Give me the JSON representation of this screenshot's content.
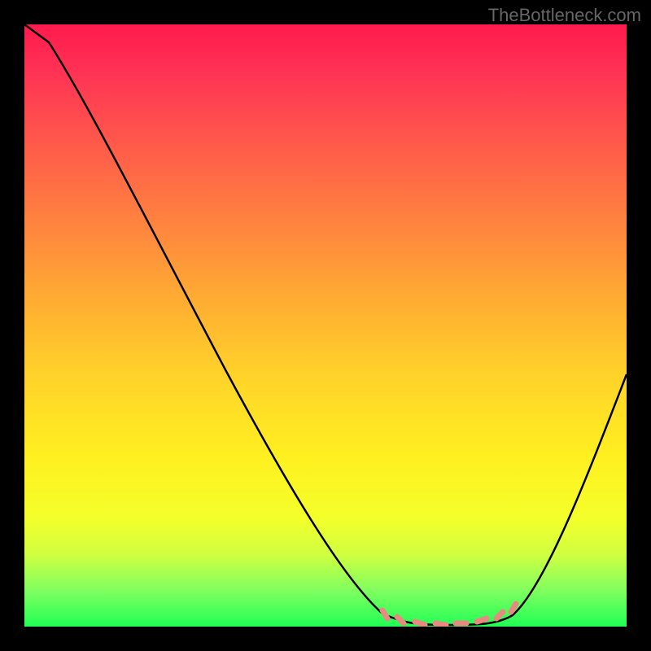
{
  "watermark": "TheBottleneck.com",
  "chart_data": {
    "type": "line",
    "title": "",
    "xlabel": "",
    "ylabel": "",
    "xlim": [
      0,
      100
    ],
    "ylim": [
      0,
      100
    ],
    "background_gradient": {
      "top_color": "#ff1a4d",
      "bottom_color": "#20ff55",
      "description": "vertical gradient red (top, bad) through orange/yellow to green (bottom, good)"
    },
    "series": [
      {
        "name": "bottleneck-curve",
        "color": "#000000",
        "x": [
          0,
          5,
          10,
          15,
          20,
          25,
          30,
          35,
          40,
          45,
          50,
          55,
          60,
          65,
          70,
          75,
          80,
          85,
          90,
          95,
          100
        ],
        "y_pct": [
          100,
          97,
          88,
          79,
          70,
          61,
          52,
          43,
          34,
          25,
          16,
          8,
          2,
          0.3,
          0.2,
          0.2,
          0.3,
          3,
          14,
          27,
          42
        ],
        "note": "y_pct = vertical position as percent of plot height from bottom (0 = bottom/green, 100 = top/red). Curve descends steeply from top-left, reaches near-zero minimum around x≈63–80, then rises toward right."
      }
    ],
    "markers": {
      "description": "short salmon-colored tick segments along the curve near the minimum",
      "color": "#e88a82",
      "positions_x": [
        60,
        63,
        66,
        69,
        72,
        75,
        78,
        81
      ]
    }
  }
}
